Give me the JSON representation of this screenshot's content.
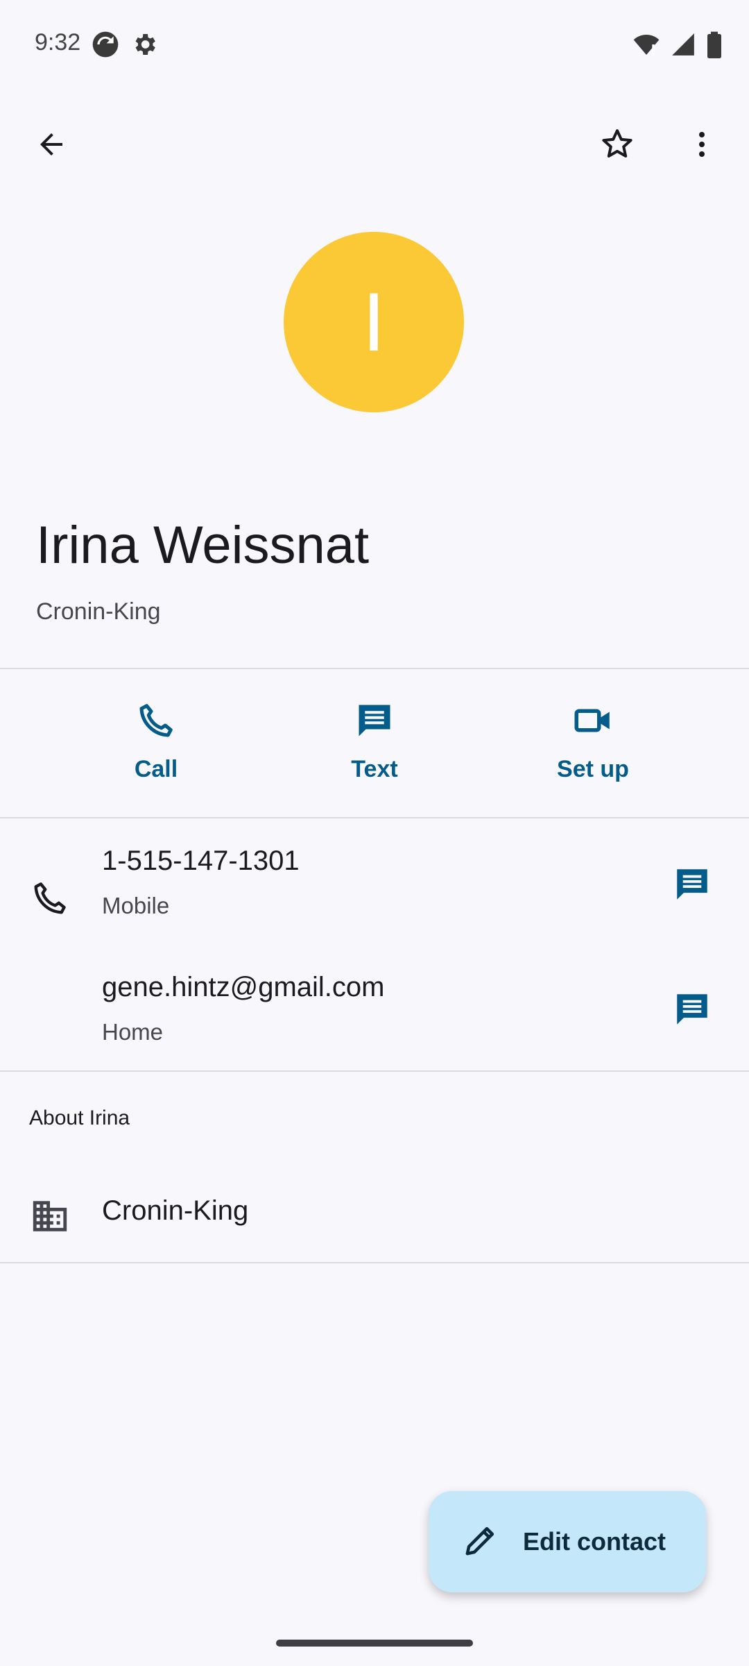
{
  "status_bar": {
    "time": "9:32",
    "left_icons": [
      "sync-icon",
      "settings-gear-icon"
    ],
    "right_icons": [
      "wifi-alert-icon",
      "cell-signal-icon",
      "battery-icon"
    ]
  },
  "toolbar": {
    "icons": [
      "back-arrow-icon",
      "star-outline-icon",
      "more-vert-icon"
    ]
  },
  "avatar": {
    "initial": "I",
    "color": "#fbc935"
  },
  "contact": {
    "name": "Irina Weissnat",
    "company": "Cronin-King"
  },
  "actions": [
    {
      "label": "Call",
      "icon": "phone-icon"
    },
    {
      "label": "Text",
      "icon": "message-icon"
    },
    {
      "label": "Set up",
      "icon": "video-icon"
    }
  ],
  "details": {
    "phone": {
      "value": "1-515-147-1301",
      "type": "Mobile"
    },
    "email": {
      "value": "gene.hintz@gmail.com",
      "type": "Home"
    }
  },
  "about": {
    "title": "About Irina",
    "company": "Cronin-King"
  },
  "fab": {
    "label": "Edit contact",
    "icon": "pencil-icon"
  },
  "colors": {
    "accent": "#045c8a",
    "fab_bg": "#c5e7fa",
    "background": "#f8f7fc"
  }
}
